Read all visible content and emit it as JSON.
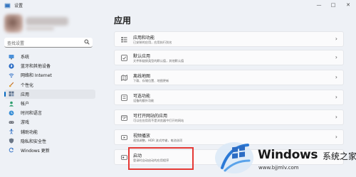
{
  "window": {
    "title": "设置",
    "controls": {
      "minimize": "—",
      "maximize": "□",
      "close": "✕"
    }
  },
  "search": {
    "placeholder": "查找设置"
  },
  "nav": [
    {
      "label": "系统",
      "icon": "monitor-icon"
    },
    {
      "label": "蓝牙和其他设备",
      "icon": "bluetooth-icon"
    },
    {
      "label": "网络和 Internet",
      "icon": "wifi-icon"
    },
    {
      "label": "个性化",
      "icon": "brush-icon"
    },
    {
      "label": "应用",
      "icon": "apps-icon",
      "active": true
    },
    {
      "label": "帐户",
      "icon": "person-icon"
    },
    {
      "label": "时间和语言",
      "icon": "globe-clock-icon"
    },
    {
      "label": "游戏",
      "icon": "gamepad-icon"
    },
    {
      "label": "辅助功能",
      "icon": "accessibility-icon"
    },
    {
      "label": "隐私和安全性",
      "icon": "shield-icon"
    },
    {
      "label": "Windows 更新",
      "icon": "update-icon"
    }
  ],
  "main": {
    "title": "应用",
    "cards": [
      {
        "title": "应用和功能",
        "desc": "已安装的应用，应用执行别名",
        "icon": "list-icon"
      },
      {
        "title": "默认应用",
        "desc": "文件和链接类型的默认值，其他默认值",
        "icon": "default-apps-icon"
      },
      {
        "title": "离线地图",
        "desc": "下载、存储位置、地图更新",
        "icon": "map-icon"
      },
      {
        "title": "可选功能",
        "desc": "设备的额外功能",
        "icon": "optional-icon"
      },
      {
        "title": "可打开网站的应用",
        "desc": "可以在应用而不是浏览器中打开的网站",
        "icon": "link-window-icon"
      },
      {
        "title": "视频播放",
        "desc": "视频调整，HDR 流式传输，电池选项",
        "icon": "video-icon"
      },
      {
        "title": "启动",
        "desc": "登录时自动启动的应用程序",
        "icon": "startup-icon"
      }
    ]
  },
  "watermark": {
    "brand": "Windows",
    "cn": "系统之家",
    "url": "www.bjjmlv.com"
  },
  "colors": {
    "accent": "#0067c0",
    "highlight": "#e53935",
    "background": "#eef1f6"
  }
}
